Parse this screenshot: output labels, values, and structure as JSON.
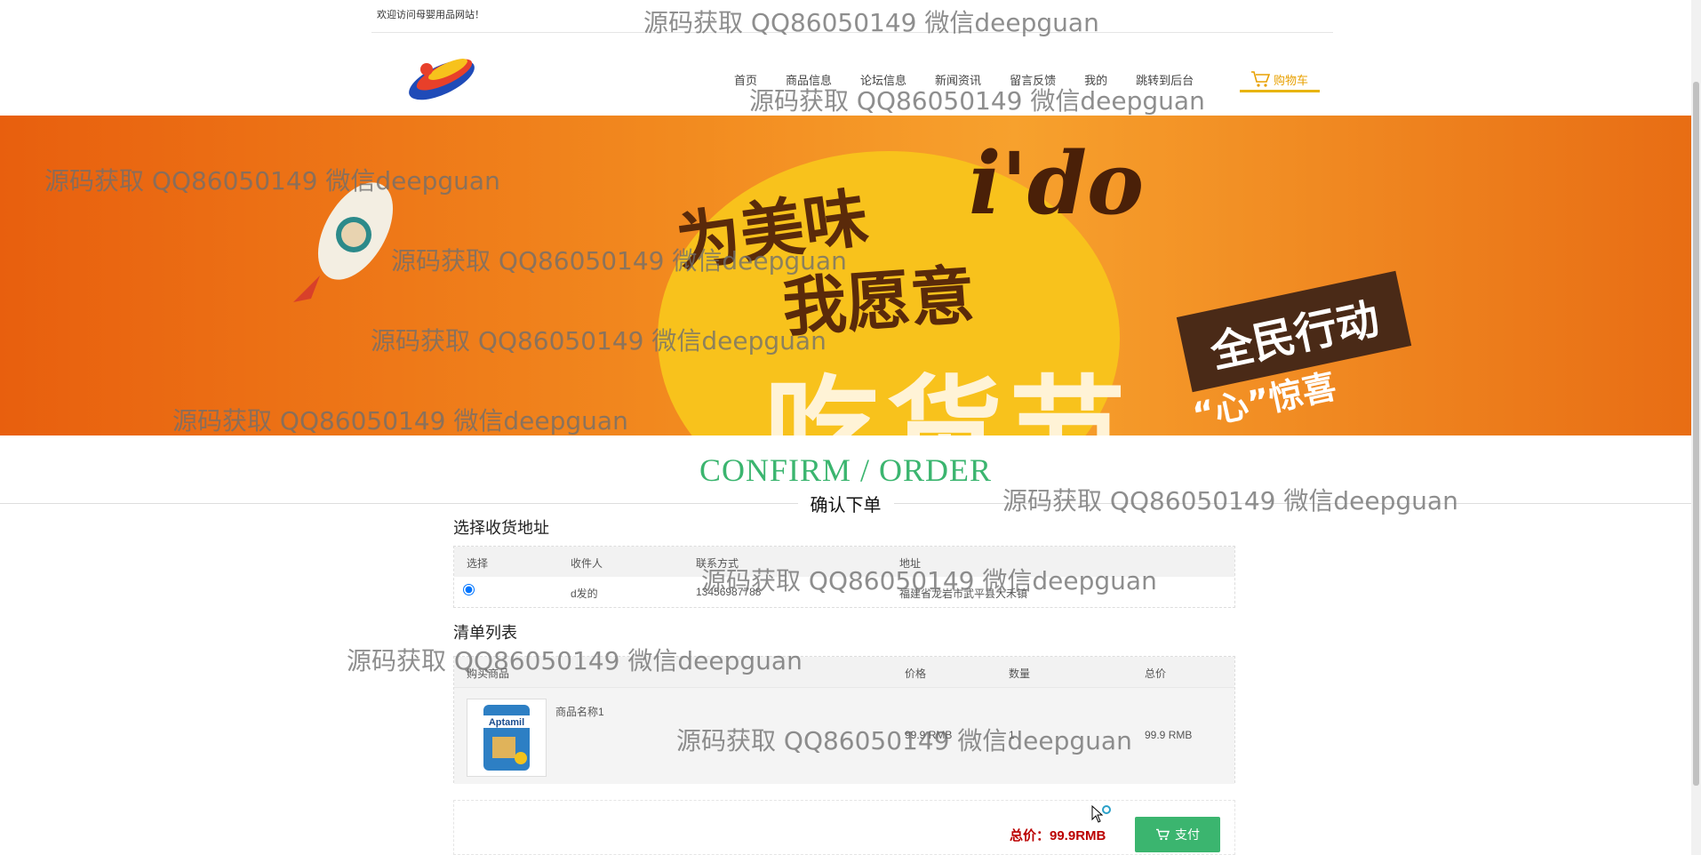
{
  "header": {
    "welcome": "欢迎访问母婴用品网站！",
    "nav": [
      "首页",
      "商品信息",
      "论坛信息",
      "新闻资讯",
      "留言反馈",
      "我的",
      "跳转到后台"
    ],
    "cart_label": "购物车"
  },
  "banner": {
    "line1": "为美味",
    "line2": "i'do",
    "line3": "我愿意",
    "line4": "吃货节",
    "tag1": "全民行动",
    "tag2": "“心”惊喜"
  },
  "page": {
    "title_en": "CONFIRM / ORDER",
    "title_cn": "确认下单"
  },
  "address": {
    "heading": "选择收货地址",
    "columns": [
      "选择",
      "收件人",
      "联系方式",
      "地址"
    ],
    "rows": [
      {
        "selected": true,
        "name": "d发的",
        "phone": "13456987788",
        "address": "福建省龙岩市武平县大禾镇"
      }
    ]
  },
  "goods": {
    "heading": "清单列表",
    "columns": [
      "购买商品",
      "价格",
      "数量",
      "总价"
    ],
    "rows": [
      {
        "name": "商品名称1",
        "price": "99.9 RMB",
        "quantity": "1",
        "total": "99.9 RMB"
      }
    ]
  },
  "checkout": {
    "total_label": "总价：99.9RMB",
    "pay_label": "支付"
  },
  "watermark": "源码获取 QQ86050149 微信deepguan",
  "colors": {
    "accent": "#3bb56f",
    "price": "#bb0000",
    "cart": "#e8a000"
  }
}
